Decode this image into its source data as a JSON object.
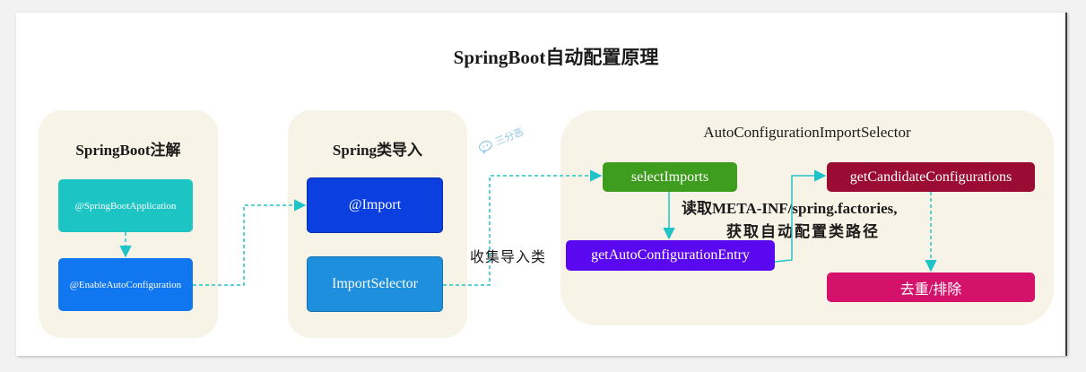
{
  "title": "SpringBoot自动配置原理",
  "panels": {
    "annotation": {
      "title": "SpringBoot注解",
      "items": [
        "@SpringBootApplication",
        "@EnableAutoConfiguration"
      ]
    },
    "import": {
      "title": "Spring类导入",
      "items": [
        "@Import",
        "ImportSelector"
      ]
    },
    "selector": {
      "title": "AutoConfigurationImportSelector",
      "items": [
        "selectImports",
        "getAutoConfigurationEntry",
        "getCandidateConfigurations",
        "去重/排除"
      ]
    }
  },
  "notes": {
    "collect": "收集导入类",
    "read_line1": "读取META-INF/spring.factories,",
    "read_line2": "获取自动配置类路径"
  },
  "watermark": "三分恶",
  "colors": {
    "teal": "#1dc4c4",
    "blue": "#1177f0",
    "dark_blue": "#0b3fe0",
    "sky_blue": "#1d8fdc",
    "green": "#3e9c1e",
    "purple": "#5a08f0",
    "maroon": "#9b0c34",
    "pink": "#d4126c",
    "arrow": "#20c4c8",
    "panel_bg": "#f7f3e6"
  }
}
